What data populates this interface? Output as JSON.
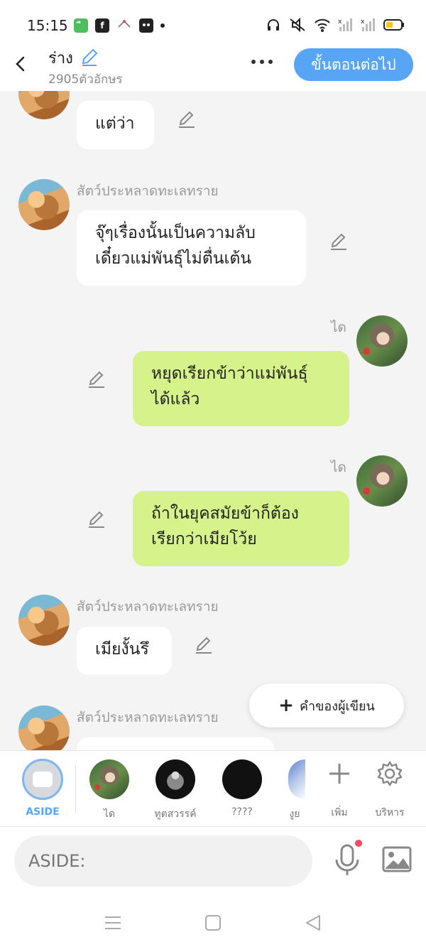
{
  "status_bar": {
    "time": "15:15",
    "icons_left": [
      "green-app-icon",
      "facebook-icon",
      "game-icon",
      "camera-app-icon",
      "notification-dot-icon"
    ],
    "icons_right": [
      "headphones-icon",
      "mute-icon",
      "wifi-icon",
      "signal-1-icon",
      "signal-2-icon",
      "battery-icon"
    ]
  },
  "header": {
    "title": "ร่าง",
    "char_count": "2905ตัวอักษร",
    "next_button": "ขั้นตอนต่อไป"
  },
  "messages": [
    {
      "side": "left",
      "speaker": "",
      "text": "แต่ว่า",
      "avatar": "sand-dune"
    },
    {
      "side": "left",
      "speaker": "สัตว์ประหลาดทะเลทราย",
      "text_lines": [
        "จุ๊ๆเรื่องนั้นเป็นความลับ",
        "เดี๋ยวแม่พันธุ์ไม่ตื่นเต้น"
      ],
      "avatar": "sand-dune"
    },
    {
      "side": "right",
      "speaker": "ได",
      "text_lines": [
        "หยุดเรียกข้าว่าแม่พันธุ์",
        "ได้แล้ว"
      ],
      "avatar": "dai"
    },
    {
      "side": "right",
      "speaker": "ได",
      "text_lines": [
        "ถ้าในยุคสมัยข้าก็ต้อง",
        "เรียกว่าเมียโว้ย"
      ],
      "avatar": "dai"
    },
    {
      "side": "left",
      "speaker": "สัตว์ประหลาดทะเลทราย",
      "text": "เมียงั้นรึ",
      "avatar": "sand-dune"
    },
    {
      "side": "left",
      "speaker": "สัตว์ประหลาดทะเลทราย",
      "text": "",
      "avatar": "sand-dune"
    }
  ],
  "fab": {
    "label": "คำของผู้เขียน"
  },
  "character_bar": {
    "aside_label": "ASIDE",
    "characters": [
      {
        "label": "ได"
      },
      {
        "label": "ทูตสวรรค์"
      },
      {
        "label": "????"
      },
      {
        "label": "งูย"
      }
    ],
    "add_label": "เพิ่ม",
    "manage_label": "บริหาร"
  },
  "input": {
    "placeholder": "ASIDE:"
  },
  "colors": {
    "accent": "#58a4f5",
    "bubble_green": "#d6f28a",
    "bubble_white": "#ffffff",
    "mic_badge": "#f04b5d"
  }
}
